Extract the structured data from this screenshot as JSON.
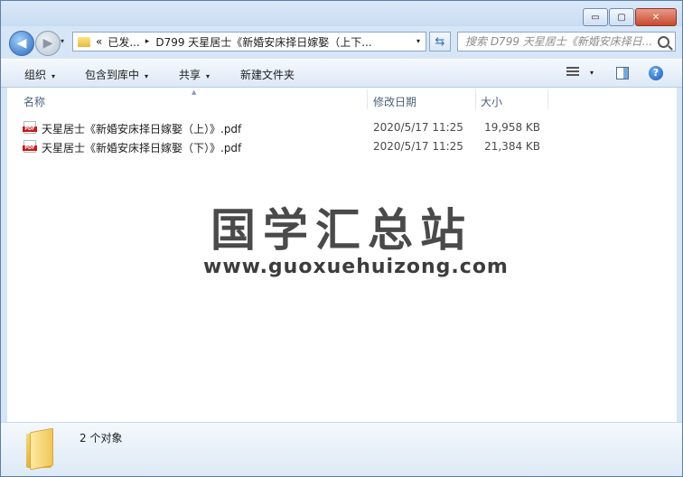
{
  "window": {
    "controls": {
      "minimize": "▭",
      "maximize": "▢",
      "close": "✕"
    }
  },
  "nav": {
    "back_icon": "◀",
    "forward_icon": "▶",
    "history_caret": "▾",
    "breadcrumbs": [
      "«",
      "已发...",
      "▸",
      "D799 天星居士《新婚安床择日嫁娶（上下..."
    ],
    "address_caret": "▾",
    "refresh_icon": "⇆",
    "search_placeholder": "搜索 D799 天星居士《新婚安床择日..."
  },
  "toolbar": {
    "organize": "组织",
    "include_library": "包含到库中",
    "share": "共享",
    "new_folder": "新建文件夹",
    "caret": "▾",
    "help": "?"
  },
  "columns": {
    "name": "名称",
    "modified": "修改日期",
    "size": "大小",
    "sort_arrow": "▲"
  },
  "files": [
    {
      "name": "天星居士《新婚安床择日嫁娶（上）》.pdf",
      "modified": "2020/5/17 11:25",
      "size": "19,958 KB"
    },
    {
      "name": "天星居士《新婚安床择日嫁娶（下）》.pdf",
      "modified": "2020/5/17 11:25",
      "size": "21,384 KB"
    }
  ],
  "watermark": {
    "title": "国学汇总站",
    "url": "www.guoxuehuizong.com"
  },
  "status": {
    "count_text": "2 个对象"
  }
}
